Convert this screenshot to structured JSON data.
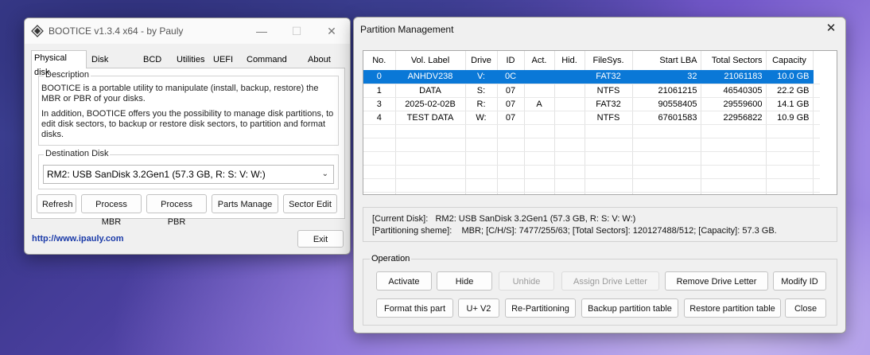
{
  "bootice": {
    "title": "BOOTICE v1.3.4 x64 - by Pauly",
    "tabs": [
      "Physical disk",
      "Disk image",
      "BCD",
      "Utilities",
      "UEFI",
      "Command line",
      "About"
    ],
    "description_label": "Description",
    "description_p1": "BOOTICE is a portable utility to manipulate (install, backup, restore) the MBR or PBR of your disks.",
    "description_p2": "In addition, BOOTICE offers you the possibility to manage disk partitions, to edit disk sectors, to backup or restore disk sectors, to partition and format disks.",
    "destination_label": "Destination Disk",
    "destination_value": "RM2:  USB SanDisk 3.2Gen1 (57.3 GB, R: S: V: W:)",
    "buttons": {
      "refresh": "Refresh",
      "process_mbr": "Process MBR",
      "process_pbr": "Process PBR",
      "parts_manage": "Parts Manage",
      "sector_edit": "Sector Edit",
      "exit": "Exit"
    },
    "link": "http://www.ipauly.com"
  },
  "partition": {
    "title": "Partition Management",
    "columns": [
      "No.",
      "Vol. Label",
      "Drive",
      "ID",
      "Act.",
      "Hid.",
      "FileSys.",
      "Start LBA",
      "Total Sectors",
      "Capacity"
    ],
    "rows": [
      [
        "0",
        "ANHDV238",
        "V:",
        "0C",
        "",
        "",
        "FAT32",
        "32",
        "21061183",
        "10.0 GB"
      ],
      [
        "1",
        "DATA",
        "S:",
        "07",
        "",
        "",
        "NTFS",
        "21061215",
        "46540305",
        "22.2 GB"
      ],
      [
        "3",
        "2025-02-02B",
        "R:",
        "07",
        "A",
        "",
        "FAT32",
        "90558405",
        "29559600",
        "14.1 GB"
      ],
      [
        "4",
        "TEST DATA",
        "W:",
        "07",
        "",
        "",
        "NTFS",
        "67601583",
        "22956822",
        "10.9 GB"
      ]
    ],
    "selected_row": 0,
    "current_disk_label": "[Current Disk]:",
    "current_disk_value": "RM2:  USB SanDisk 3.2Gen1 (57.3 GB, R: S: V: W:)",
    "partitioning_label": "[Partitioning sheme]:",
    "partitioning_value": "MBR;      [C/H/S]: 7477/255/63; [Total Sectors]: 120127488/512; [Capacity]: 57.3 GB.",
    "operation_label": "Operation",
    "buttons": {
      "activate": "Activate",
      "hide": "Hide",
      "unhide": "Unhide",
      "assign_letter": "Assign Drive Letter",
      "remove_letter": "Remove Drive Letter",
      "modify_id": "Modify ID",
      "format": "Format this part",
      "u_v2": "U+ V2",
      "repartition": "Re-Partitioning",
      "backup": "Backup partition table",
      "restore": "Restore partition table",
      "close": "Close"
    }
  }
}
